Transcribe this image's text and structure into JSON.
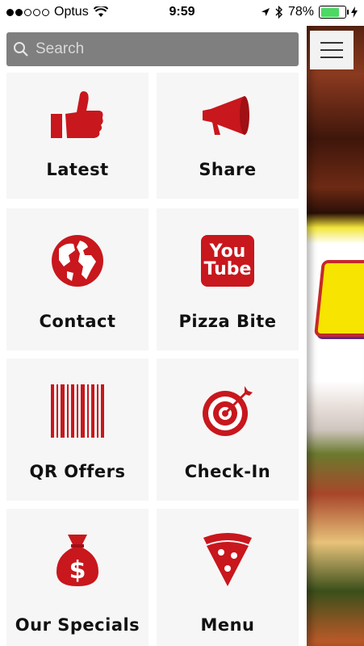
{
  "status": {
    "carrier": "Optus",
    "time": "9:59",
    "battery": "78%",
    "battery_fraction": 0.78
  },
  "search": {
    "placeholder": "Search"
  },
  "tiles": [
    {
      "label": "Latest",
      "icon": "thumbs-up-icon"
    },
    {
      "label": "Share",
      "icon": "megaphone-icon"
    },
    {
      "label": "Contact",
      "icon": "globe-icon"
    },
    {
      "label": "Pizza Bite",
      "icon": "youtube-icon"
    },
    {
      "label": "QR Offers",
      "icon": "barcode-icon"
    },
    {
      "label": "Check-In",
      "icon": "target-icon"
    },
    {
      "label": "Our Specials",
      "icon": "money-bag-icon"
    },
    {
      "label": "Menu",
      "icon": "pizza-slice-icon"
    }
  ],
  "youtube_badge": {
    "line1": "You",
    "line2": "Tube"
  },
  "colors": {
    "accent": "#c8171d",
    "tile_bg": "#f6f6f6",
    "search_bg": "#7f7f7f"
  }
}
